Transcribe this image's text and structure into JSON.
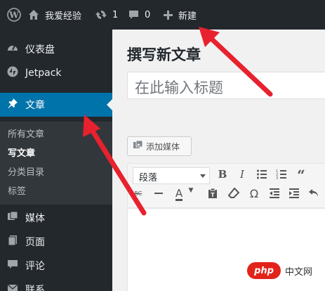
{
  "adminbar": {
    "site_name": "我爱经验",
    "updates_count": "1",
    "comments_count": "0",
    "new_label": "新建",
    "icons": {
      "logo": "wordpress-logo-icon",
      "home": "home-icon",
      "updates": "refresh-icon",
      "comments": "comment-icon",
      "new": "plus-icon"
    }
  },
  "sidebar": {
    "items": [
      {
        "label": "仪表盘",
        "icon": "dashboard-icon"
      },
      {
        "label": "Jetpack",
        "icon": "jetpack-icon"
      },
      {
        "label": "文章",
        "icon": "pin-icon",
        "current": true
      },
      {
        "label": "媒体",
        "icon": "media-icon"
      },
      {
        "label": "页面",
        "icon": "page-icon"
      },
      {
        "label": "评论",
        "icon": "comment-icon"
      },
      {
        "label": "联系",
        "icon": "contact-icon"
      }
    ],
    "submenu": [
      {
        "label": "所有文章"
      },
      {
        "label": "写文章",
        "active": true
      },
      {
        "label": "分类目录"
      },
      {
        "label": "标签"
      }
    ]
  },
  "main": {
    "page_title": "撰写新文章",
    "title_placeholder": "在此输入标题",
    "add_media_label": "添加媒体",
    "format_select": "段落"
  },
  "watermark": {
    "badge": "php",
    "text": "中文网"
  },
  "colors": {
    "admin_bg": "#23282d",
    "accent": "#0073aa",
    "arrow": "#e8212e"
  }
}
